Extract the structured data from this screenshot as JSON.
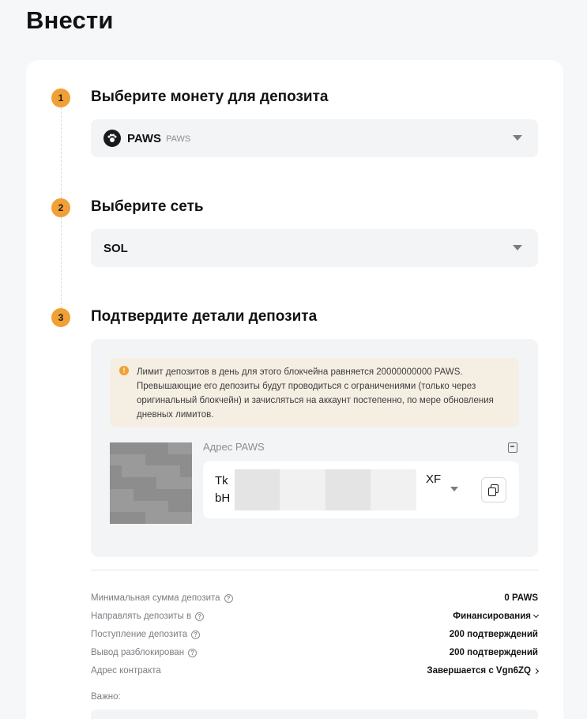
{
  "page": {
    "title": "Внести"
  },
  "steps": [
    {
      "num": "1",
      "title": "Выберите монету для депозита"
    },
    {
      "num": "2",
      "title": "Выберите сеть"
    },
    {
      "num": "3",
      "title": "Подтвердите детали депозита"
    }
  ],
  "coin": {
    "symbol": "PAWS",
    "name": "PAWS"
  },
  "network": {
    "value": "SOL"
  },
  "notice": {
    "text": "Лимит депозитов в день для этого блокчейна равняется 20000000000 PAWS. Превышающие его депозиты будут проводиться с ограничениями (только через оригинальный блокчейн) и зачисляться на аккаунт постепенно, по мере обновления дневных лимитов."
  },
  "address": {
    "label": "Адрес PAWS",
    "line1_start": "Tk",
    "line1_end": "XF",
    "line2_start": "bH"
  },
  "info": [
    {
      "label": "Минимальная сумма депозита",
      "value": "0 PAWS"
    },
    {
      "label": "Направлять депозиты в",
      "value": "Финансирования"
    },
    {
      "label": "Поступление депозита",
      "value": "200 подтверждений"
    },
    {
      "label": "Вывод разблокирован",
      "value": "200 подтверждений"
    },
    {
      "label": "Адрес контракта",
      "value": "Завершается с Vgn6ZQ"
    }
  ],
  "important": {
    "label": "Важно:"
  },
  "colors": {
    "accent": "#f0a034",
    "notice_bg": "#f5eee3",
    "field_bg": "#f3f4f6"
  }
}
